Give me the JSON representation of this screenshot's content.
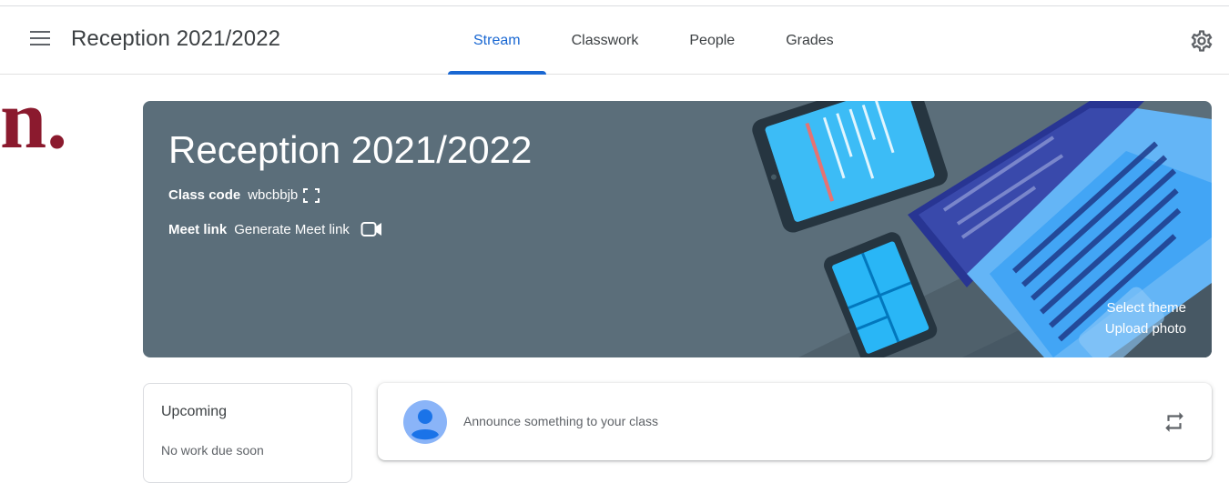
{
  "header": {
    "course_title": "Reception 2021/2022",
    "tabs": [
      {
        "label": "Stream",
        "active": true
      },
      {
        "label": "Classwork",
        "active": false
      },
      {
        "label": "People",
        "active": false
      },
      {
        "label": "Grades",
        "active": false
      }
    ]
  },
  "brand_fragment": "n.",
  "banner": {
    "title": "Reception 2021/2022",
    "class_code_label": "Class code",
    "class_code_value": "wbcbbjb",
    "meet_link_label": "Meet link",
    "meet_link_value": "Generate Meet link",
    "select_theme": "Select theme",
    "upload_photo": "Upload photo",
    "background_color": "#5b6e7a"
  },
  "upcoming": {
    "title": "Upcoming",
    "subtitle": "No work due soon"
  },
  "announce": {
    "placeholder": "Announce something to your class"
  },
  "colors": {
    "accent": "#1967d2",
    "brand": "#8b1a2e"
  },
  "icons": [
    "menu-icon",
    "settings-icon",
    "fullscreen-icon",
    "video-camera-icon",
    "avatar-icon",
    "repost-icon"
  ]
}
